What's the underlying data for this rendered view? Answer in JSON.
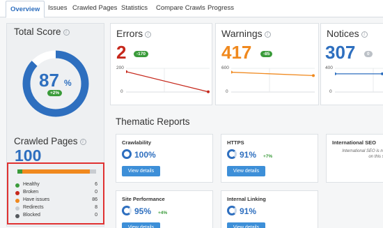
{
  "tabs": [
    {
      "label": "Overview",
      "active": true
    },
    {
      "label": "Issues"
    },
    {
      "label": "Crawled Pages"
    },
    {
      "label": "Statistics"
    },
    {
      "label": "Compare Crawls"
    },
    {
      "label": "Progress"
    }
  ],
  "total_score": {
    "title": "Total Score",
    "value": "87",
    "unit": "%",
    "delta": "+2%",
    "percent": 87
  },
  "crawled_pages": {
    "title": "Crawled Pages",
    "value": "100",
    "legend": [
      {
        "label": "Healthy",
        "value": "6",
        "color": "#3a9b3a"
      },
      {
        "label": "Broken",
        "value": "0",
        "color": "#c6281c"
      },
      {
        "label": "Have issues",
        "value": "86",
        "color": "#f0891e"
      },
      {
        "label": "Redirects",
        "value": "8",
        "color": "#c8ccd1"
      },
      {
        "label": "Blocked",
        "value": "0",
        "color": "#55595e"
      }
    ]
  },
  "errors": {
    "title": "Errors",
    "value": "2",
    "delta": "-170",
    "color": "#c6281c",
    "axis_top": "200",
    "axis_bottom": "0",
    "chart_values": [
      172,
      2
    ],
    "chart_max": 200
  },
  "warnings": {
    "title": "Warnings",
    "value": "417",
    "delta": "-85",
    "color": "#f0891e",
    "axis_top": "600",
    "axis_bottom": "0",
    "chart_values": [
      502,
      417
    ],
    "chart_max": 600
  },
  "notices": {
    "title": "Notices",
    "value": "307",
    "delta": "0",
    "color": "#2e6fbf",
    "axis_top": "400",
    "axis_bottom": "0",
    "chart_values": [
      307,
      307
    ],
    "chart_max": 400
  },
  "thematic": {
    "title": "Thematic Reports",
    "cards": [
      {
        "title": "Crawlability",
        "value": "100%",
        "delta": "",
        "button": "View details"
      },
      {
        "title": "HTTPS",
        "value": "91%",
        "delta": "+7%",
        "button": "View details"
      },
      {
        "title": "International SEO",
        "note_line1": "International SEO is no",
        "note_line2": "on this si"
      },
      {
        "title": "Site Performance",
        "value": "95%",
        "delta": "+4%",
        "button": "View details"
      },
      {
        "title": "Internal Linking",
        "value": "91%",
        "delta": "",
        "button": "View details"
      }
    ]
  }
}
